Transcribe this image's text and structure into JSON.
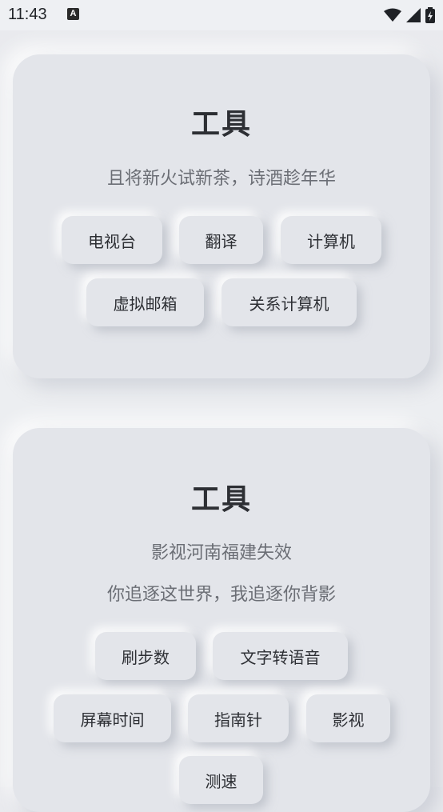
{
  "status_bar": {
    "time": "11:43",
    "notification_icon_letter": "A"
  },
  "card1": {
    "title": "工具",
    "subtitle": "且将新火试新茶，诗酒趁年华",
    "buttons": [
      "电视台",
      "翻译",
      "计算机",
      "虚拟邮箱",
      "关系计算机"
    ]
  },
  "card2": {
    "title": "工具",
    "subtitle_1": "影视河南福建失效",
    "subtitle_2": "你追逐这世界，我追逐你背影",
    "buttons": [
      "刷步数",
      "文字转语音",
      "屏幕时间",
      "指南针",
      "影视",
      "测速"
    ]
  },
  "colors": {
    "card": "#e3e5ea",
    "background": "#eceef1",
    "text": "#2d2f34",
    "subtitle": "#6b6e75"
  }
}
